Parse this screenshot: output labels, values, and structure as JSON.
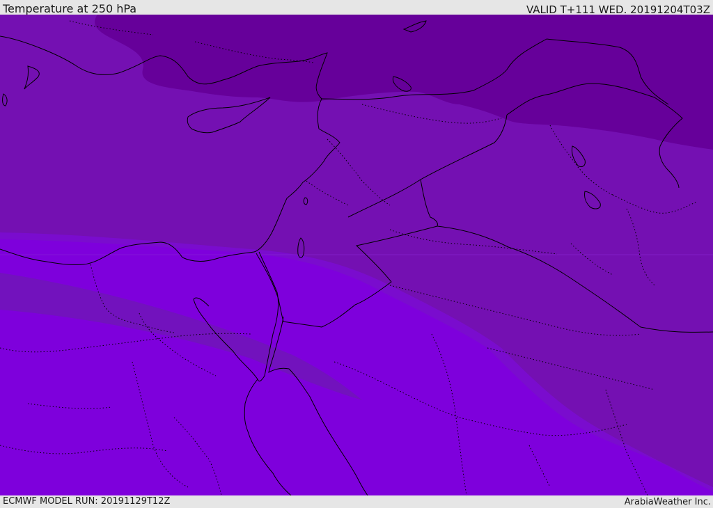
{
  "header": {
    "title": "Temperature at 250 hPa",
    "valid": "VALID T+111 WED. 20191204T03Z"
  },
  "footer": {
    "model_run": "ECMWF MODEL RUN: 20191129T12Z",
    "credit": "ArabiaWeather Inc."
  },
  "map": {
    "colors": {
      "band_coldest": "#66009a",
      "band_cold": "#7410b2",
      "band_mid": "#7a0cce",
      "band_stripe": "#7212bd",
      "band_warm": "#7e00dc",
      "coastline": "#000000",
      "border_dotted": "#000000"
    }
  }
}
